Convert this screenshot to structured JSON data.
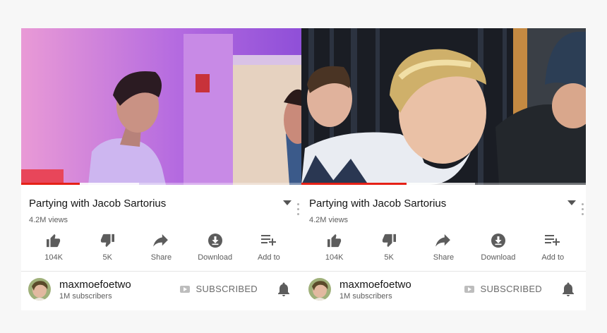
{
  "colors": {
    "progress_played": "#e62117",
    "icon_gray": "#5c5c5c",
    "text_primary": "#141414"
  },
  "panels": [
    {
      "video": {
        "played_fraction": 0.21,
        "buffered_fraction": 0.42,
        "scene": "purple-hallway"
      },
      "title": "Partying with Jacob Sartorius",
      "views": "4.2M views",
      "actions": [
        {
          "icon": "thumbs-up-icon",
          "label": "104K"
        },
        {
          "icon": "thumbs-down-icon",
          "label": "5K"
        },
        {
          "icon": "share-icon",
          "label": "Share"
        },
        {
          "icon": "download-icon",
          "label": "Download"
        },
        {
          "icon": "playlist-add-icon",
          "label": "Add to"
        }
      ],
      "channel": {
        "name": "maxmoefoetwo",
        "subscribers": "1M subscribers",
        "subscribed_label": "SUBSCRIBED"
      }
    },
    {
      "video": {
        "played_fraction": 0.37,
        "buffered_fraction": 0.61,
        "scene": "dark-curtain"
      },
      "title": "Partying with Jacob Sartorius",
      "views": "4.2M views",
      "actions": [
        {
          "icon": "thumbs-up-icon",
          "label": "104K"
        },
        {
          "icon": "thumbs-down-icon",
          "label": "5K"
        },
        {
          "icon": "share-icon",
          "label": "Share"
        },
        {
          "icon": "download-icon",
          "label": "Download"
        },
        {
          "icon": "playlist-add-icon",
          "label": "Add to"
        }
      ],
      "channel": {
        "name": "maxmoefoetwo",
        "subscribers": "1M subscribers",
        "subscribed_label": "SUBSCRIBED"
      }
    }
  ]
}
